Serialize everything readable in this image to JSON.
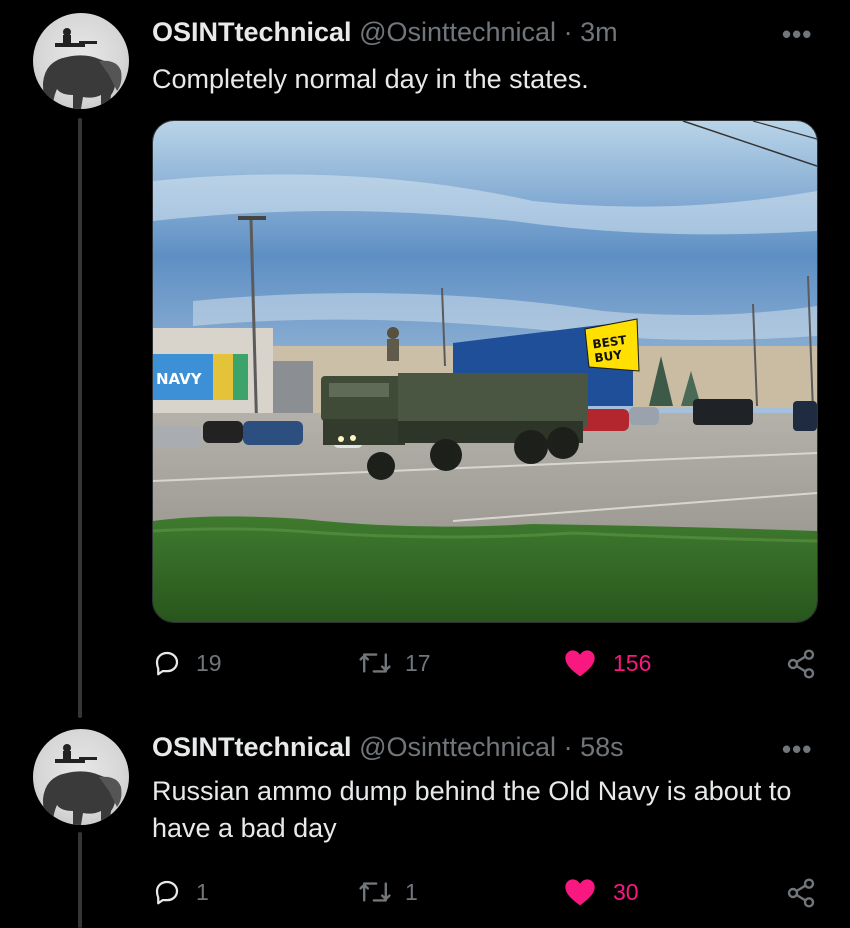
{
  "tweets": [
    {
      "display_name": "OSINTtechnical",
      "handle": "@Osinttechnical",
      "separator": " · ",
      "time": "3m",
      "text": "Completely normal day in the states.",
      "media_signs": {
        "store_left": "NAVY",
        "store_right_line1": "BEST",
        "store_right_line2": "BUY"
      },
      "replies": "19",
      "retweets": "17",
      "likes": "156",
      "liked": true
    },
    {
      "display_name": "OSINTtechnical",
      "handle": "@Osinttechnical",
      "separator": " · ",
      "time": "58s",
      "text": "Russian ammo dump behind the Old Navy is about to have a bad day",
      "replies": "1",
      "retweets": "1",
      "likes": "30",
      "liked": true
    }
  ],
  "icons": {
    "more": "more-icon",
    "reply": "reply-icon",
    "retweet": "retweet-icon",
    "like": "heart-icon",
    "share": "share-icon"
  },
  "colors": {
    "like": "#f91880",
    "muted": "#71767b",
    "background": "#000000"
  },
  "more_glyph": "•••"
}
